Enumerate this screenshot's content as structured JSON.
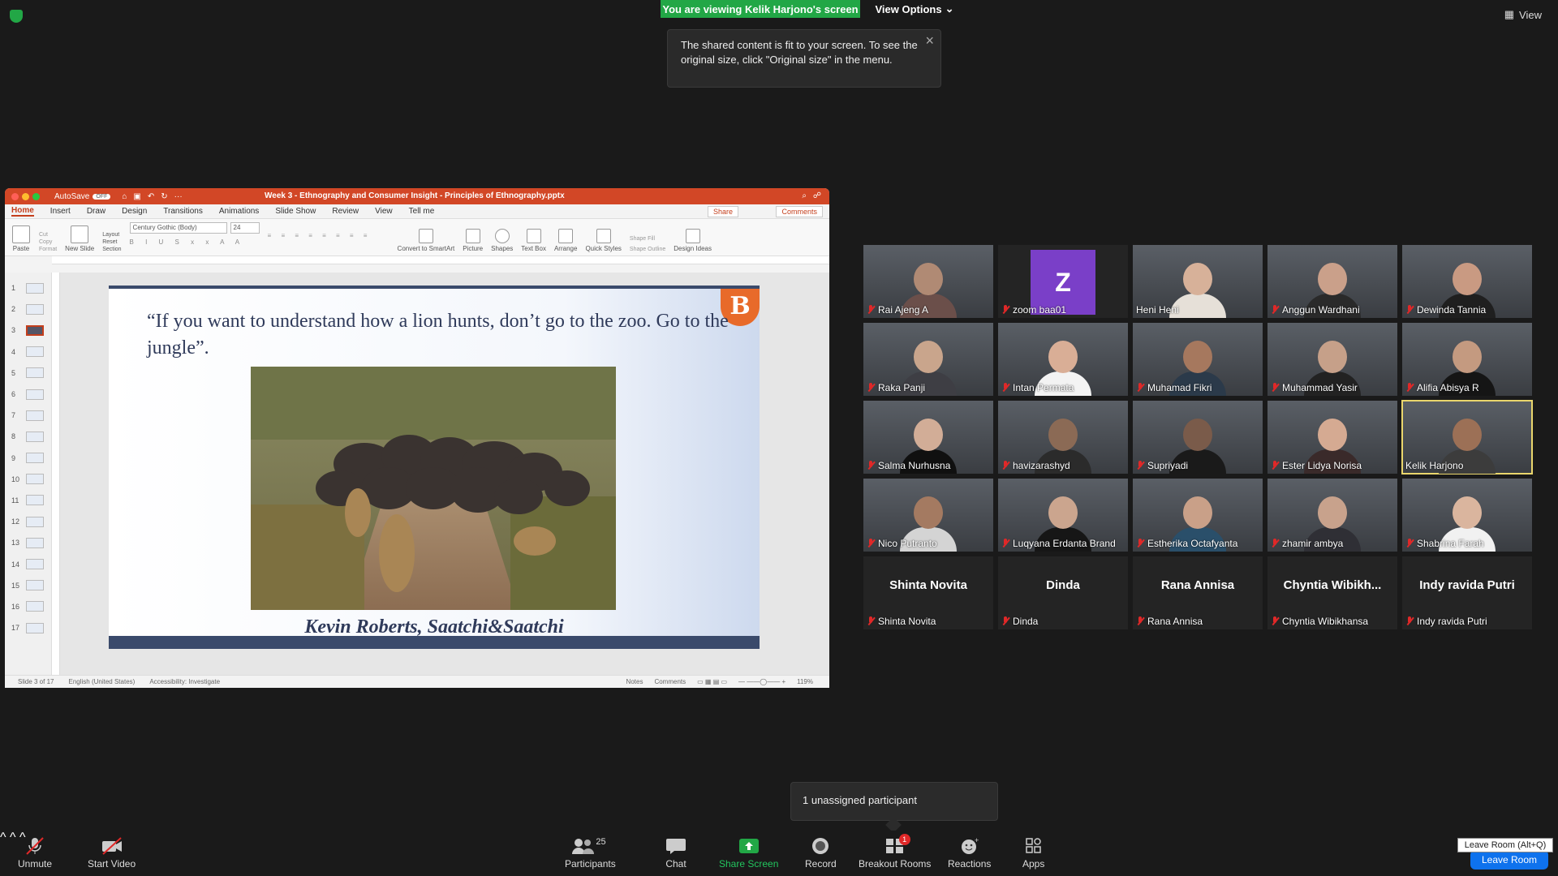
{
  "banner": {
    "viewing_text": "You are viewing Kelik Harjono's screen",
    "view_options_label": "View Options",
    "view_label": "View"
  },
  "tooltip": {
    "text": "The shared content is fit to your screen. To see the original size, click \"Original size\" in the menu."
  },
  "ppt": {
    "title": "Week 3 - Ethnography and Consumer Insight - Principles of Ethnography.pptx",
    "autosave": "AutoSave",
    "autosave_state": "OFF",
    "tabs": [
      "Home",
      "Insert",
      "Draw",
      "Design",
      "Transitions",
      "Animations",
      "Slide Show",
      "Review",
      "View",
      "Tell me"
    ],
    "active_tab": "Home",
    "share_label": "Share",
    "comments_label": "Comments",
    "ribbon": {
      "paste": "Paste",
      "cut": "Cut",
      "copy": "Copy",
      "format": "Format",
      "new_slide": "New Slide",
      "layout": "Layout",
      "reset": "Reset",
      "section": "Section",
      "font": "Century Gothic (Body)",
      "size": "24",
      "convert": "Convert to SmartArt",
      "picture": "Picture",
      "shapes": "Shapes",
      "text_box": "Text Box",
      "arrange": "Arrange",
      "quick_styles": "Quick Styles",
      "shape_fill": "Shape Fill",
      "shape_outline": "Shape Outline",
      "design_ideas": "Design Ideas"
    },
    "slide_numbers": [
      "1",
      "2",
      "3",
      "4",
      "5",
      "6",
      "7",
      "8",
      "9",
      "10",
      "11",
      "12",
      "13",
      "14",
      "15",
      "16",
      "17"
    ],
    "active_slide": 3,
    "slide": {
      "quote": "“If you want to understand how a lion hunts, don’t go to the zoo. Go to the jungle”.",
      "author": "Kevin Roberts, Saatchi&Saatchi",
      "logo": "B"
    },
    "status": {
      "slide_of": "Slide 3 of 17",
      "language": "English (United States)",
      "accessibility": "Accessibility: Investigate",
      "notes": "Notes",
      "comments": "Comments",
      "zoom": "119%"
    }
  },
  "participants": [
    {
      "name": "Rai Ajeng A",
      "video": true,
      "skin": "#b08a74",
      "shirt": "#6b4f4a"
    },
    {
      "name": "zoom baa01",
      "video": false,
      "avatar": "Z"
    },
    {
      "name": "Heni Heni",
      "video": true,
      "muted": false,
      "skin": "#d7b199",
      "shirt": "#e6e0d8"
    },
    {
      "name": "Anggun Wardhani",
      "video": true,
      "skin": "#caa08a",
      "shirt": "#2a2a2a"
    },
    {
      "name": "Dewinda Tannia",
      "video": true,
      "skin": "#c99a82",
      "shirt": "#1f1f1f"
    },
    {
      "name": "Raka Panji",
      "video": true,
      "skin": "#c9a58c",
      "shirt": "#3e3e44"
    },
    {
      "name": "Intan Permata",
      "video": true,
      "skin": "#d9ae96",
      "shirt": "#f3f3f3"
    },
    {
      "name": "Muhamad Fikri",
      "video": true,
      "skin": "#a6785e",
      "shirt": "#2b3a4a"
    },
    {
      "name": "Muhammad Yasir",
      "video": true,
      "skin": "#c6a089",
      "shirt": "#222222"
    },
    {
      "name": "Alifia Abisya R",
      "video": true,
      "skin": "#c49a80",
      "shirt": "#151515"
    },
    {
      "name": "Salma Nurhusna",
      "video": true,
      "skin": "#d2ad97",
      "shirt": "#101010"
    },
    {
      "name": "havizarashyd",
      "video": true,
      "skin": "#8b6a55",
      "shirt": "#2b2b2b"
    },
    {
      "name": "Supriyadi",
      "video": true,
      "skin": "#7a5b4a",
      "shirt": "#1a1a1a"
    },
    {
      "name": "Ester Lidya Norisa",
      "video": true,
      "skin": "#d5aa92",
      "shirt": "#3a2a2a"
    },
    {
      "name": "Kelik Harjono",
      "video": true,
      "active": true,
      "muted": false,
      "skin": "#9c7056",
      "shirt": "#3c3c3c"
    },
    {
      "name": "Nico Putranto",
      "video": true,
      "skin": "#a47a61",
      "shirt": "#d4d4d4"
    },
    {
      "name": "Luqyana Erdanta Brand",
      "video": true,
      "skin": "#cba58e",
      "shirt": "#161616"
    },
    {
      "name": "Estherika Octafyanta",
      "video": true,
      "skin": "#c9a088",
      "shirt": "#2a4f6a"
    },
    {
      "name": "zhamir ambya",
      "video": true,
      "skin": "#c8a28c",
      "shirt": "#2f2f35"
    },
    {
      "name": "Shabrina Farah",
      "video": true,
      "skin": "#dab59e",
      "shirt": "#f1f1f1"
    },
    {
      "name": "Shinta Novita",
      "video": false,
      "display": "Shinta Novita"
    },
    {
      "name": "Dinda",
      "video": false,
      "display": "Dinda"
    },
    {
      "name": "Rana Annisa",
      "video": false,
      "display": "Rana Annisa"
    },
    {
      "name": "Chyntia Wibikhansa",
      "video": false,
      "display": "Chyntia  Wibikh..."
    },
    {
      "name": "Indy ravida Putri",
      "video": false,
      "display": "Indy ravida Putri"
    }
  ],
  "unassigned": {
    "text": "1 unassigned participant"
  },
  "toolbar": {
    "unmute": "Unmute",
    "start_video": "Start Video",
    "participants": "Participants",
    "participants_count": "25",
    "chat": "Chat",
    "share_screen": "Share Screen",
    "record": "Record",
    "breakout_rooms": "Breakout Rooms",
    "breakout_badge": "1",
    "reactions": "Reactions",
    "apps": "Apps",
    "leave_tip": "Leave Room (Alt+Q)",
    "leave_label": "Leave Room"
  },
  "colors": {
    "accent_green": "#22a746",
    "zoom_blue": "#0e72ed",
    "ppt_orange": "#c43e1c",
    "active_speaker": "#ead66c"
  }
}
